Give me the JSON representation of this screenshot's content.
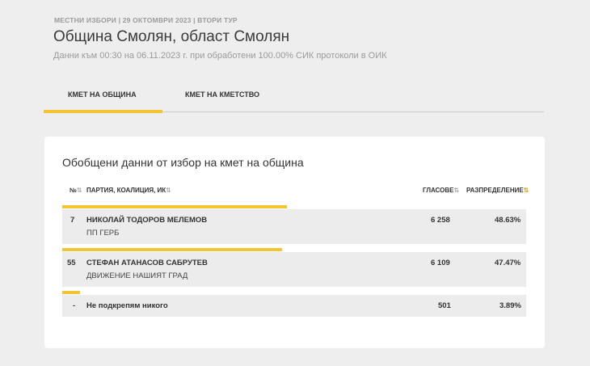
{
  "header": {
    "breadcrumb": "МЕСТНИ ИЗБОРИ | 29 ОКТОМВРИ 2023 | ВТОРИ ТУР",
    "title": "Община Смолян, област Смолян",
    "subtitle": "Данни към 00:30 на 06.11.2023 г. при обработени 100.00% СИК протоколи в ОИК"
  },
  "tabs": [
    {
      "label": "КМЕТ НА ОБЩИНА",
      "active": true
    },
    {
      "label": "КМЕТ НА КМЕТСТВО",
      "active": false
    }
  ],
  "card": {
    "title": "Обобщени данни от избор на кмет на община",
    "columns": {
      "num": "№",
      "party": "ПАРТИЯ, КОАЛИЦИЯ, ИК",
      "votes": "ГЛАСОВЕ",
      "share": "РАЗПРЕДЕЛЕНИЕ"
    },
    "rows": [
      {
        "num": "7",
        "name": "НИКОЛАЙ ТОДОРОВ МЕЛЕМОВ",
        "party": "ПП ГЕРБ",
        "votes": "6 258",
        "share": "48.63%",
        "fraction": 0.4863
      },
      {
        "num": "55",
        "name": "СТЕФАН АТАНАСОВ САБРУТЕВ",
        "party": "ДВИЖЕНИЕ НАШИЯТ ГРАД",
        "votes": "6 109",
        "share": "47.47%",
        "fraction": 0.4747
      },
      {
        "num": "-",
        "name": "Не подкрепям никого",
        "party": "",
        "votes": "501",
        "share": "3.89%",
        "fraction": 0.0389
      }
    ]
  },
  "colors": {
    "accent": "#f4c533",
    "row_bg": "#ececec",
    "page_bg": "#eeeeee"
  }
}
